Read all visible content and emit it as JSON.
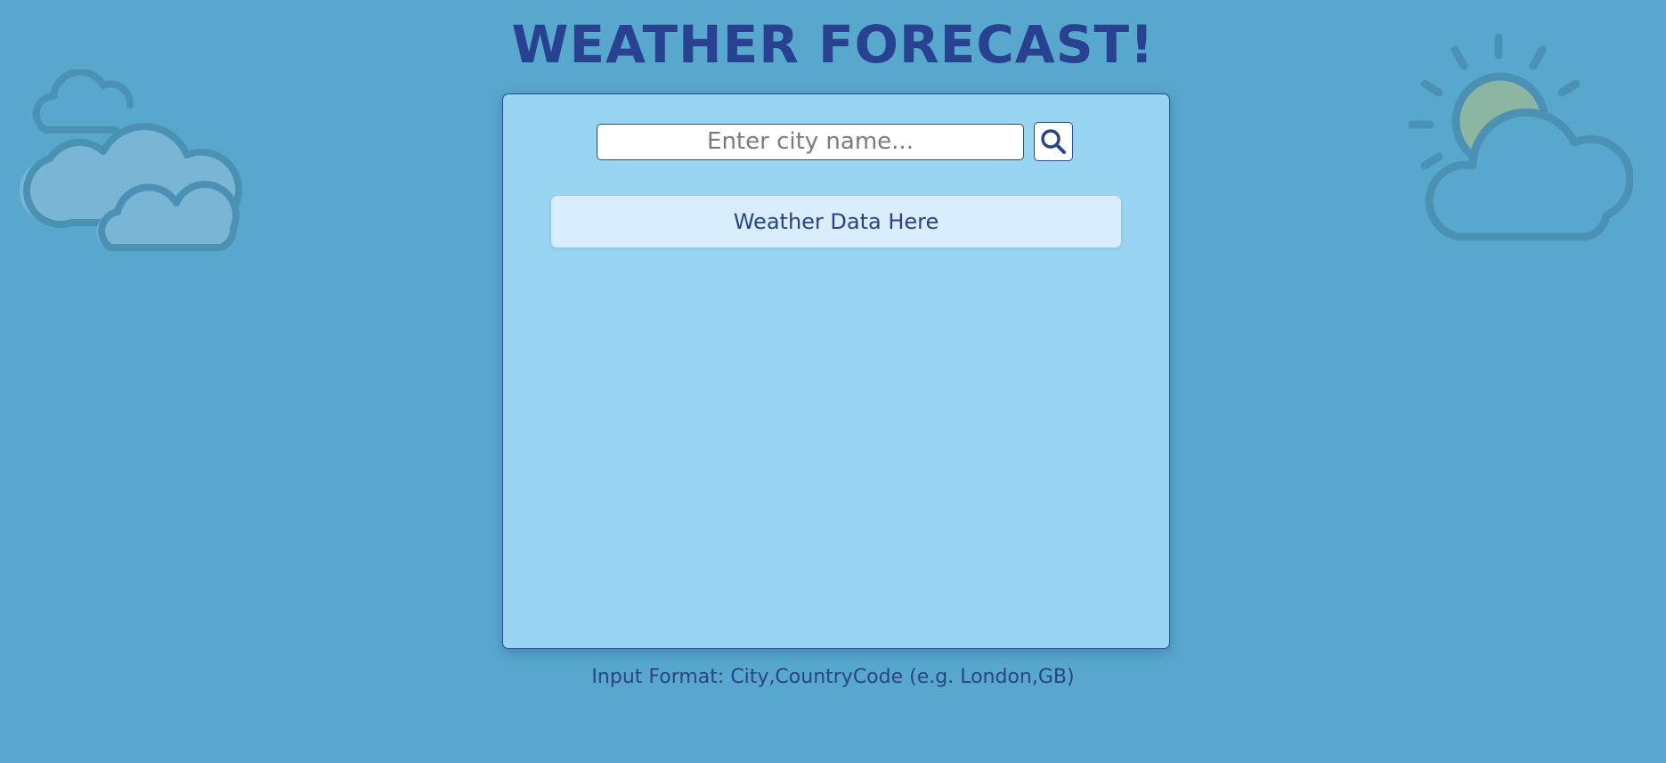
{
  "title": "WEATHER FORECAST!",
  "search": {
    "placeholder": "Enter city name...",
    "value": "",
    "button_icon": "search-icon"
  },
  "weather": {
    "placeholder_text": "Weather Data Here"
  },
  "hint": "Input Format: City,CountryCode (e.g. London,GB)",
  "decorations": {
    "left": "clouds-icon",
    "right": "sun-behind-cloud-icon"
  },
  "colors": {
    "background": "#58a8ce",
    "card": "#98d5f3",
    "accent": "#2a4387",
    "weather_box": "#d9edfc",
    "sun": "#8cb5a2"
  }
}
